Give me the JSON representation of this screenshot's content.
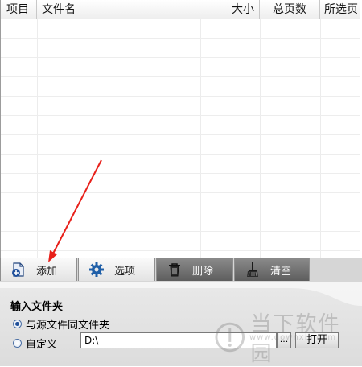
{
  "table": {
    "columns": [
      "项目",
      "文件名",
      "大小",
      "总页数",
      "所选页"
    ]
  },
  "tabs": [
    {
      "label": "添加",
      "icon": "add-file-icon"
    },
    {
      "label": "选项",
      "icon": "gear-icon"
    },
    {
      "label": "删除",
      "icon": "trash-icon"
    },
    {
      "label": "清空",
      "icon": "broom-icon"
    }
  ],
  "input_folder": {
    "title": "输入文件夹",
    "option_same": "与源文件同文件夹",
    "option_custom": "自定义",
    "path_value": "D:\\",
    "browse_label": "...",
    "open_label": "打开"
  },
  "watermark": {
    "text": "当下软件园",
    "url": "www.downxia.com"
  },
  "colors": {
    "annotation_arrow": "#e8201a",
    "tab_dark": "#6e6e6e"
  }
}
